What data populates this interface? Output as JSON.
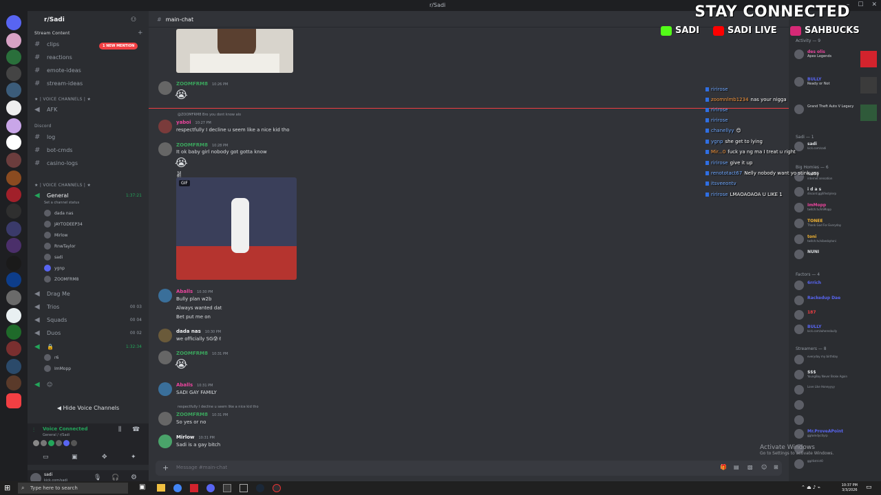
{
  "window": {
    "title": "r/Sadi"
  },
  "server": {
    "name": "r/Sadi",
    "mention_badge": "1 NEW MENTION"
  },
  "channels": {
    "stream_content_label": "Stream Content",
    "text": [
      {
        "name": "clips"
      },
      {
        "name": "reactions"
      },
      {
        "name": "emote-ideas"
      },
      {
        "name": "stream-ideas"
      }
    ],
    "voice_cat_1": "★ | VOICE CHANNELS | ★",
    "afk": "AFK",
    "discord_cat": "Discord",
    "text2": [
      {
        "name": "log"
      },
      {
        "name": "bot-cmds"
      },
      {
        "name": "casino-logs"
      }
    ],
    "voice_cat_2": "★ | VOICE CHANNELS | ★",
    "general": {
      "name": "General",
      "timer": "1:37:21",
      "status": "Set a channel status"
    },
    "voice_users": [
      "dada nas",
      "JAYTODEEP34",
      "Mirlow",
      "RnwTaylor",
      "sadi",
      "ygnp",
      "ZOOMFRM8"
    ],
    "voice2": [
      {
        "name": "Drag Me",
        "count": ""
      },
      {
        "name": "Trios",
        "count": "00 03"
      },
      {
        "name": "Squads",
        "count": "00 04"
      },
      {
        "name": "Duos",
        "count": "00 02"
      }
    ],
    "locked_timer": "1:32:34",
    "locked_users": [
      "r6",
      "ImMopp"
    ],
    "hide_label": "Hide Voice Channels",
    "voice_connected": "Voice Connected",
    "voice_sub": "General / r/Sadi",
    "user_name": "sadi",
    "user_sub": "kick.com/sadi"
  },
  "chat": {
    "channel": "main-chat",
    "composer_placeholder": "Message #main-chat",
    "messages": [
      {
        "name": "ZOOMFRM8",
        "time": "10:26 PM",
        "text": "😭"
      },
      {
        "reply": "@ZOOMFRM8 Bro you dont know alo",
        "name": "yaboi",
        "time": "10:27 PM",
        "text": "respectfully I decline u seem like a nice kid tho"
      },
      {
        "name": "ZOOMFRM8",
        "time": "10:28 PM",
        "text": "It ok baby girl nobody got gotta know",
        "text2": "😭✌"
      },
      {
        "gif_label": "GIF"
      },
      {
        "name": "Aballs",
        "time": "10:30 PM",
        "text": "Bully plan w2b",
        "text2": "Always wanted dat",
        "text3": "Bet put me on"
      },
      {
        "name": "dada nas",
        "time": "10:30 PM",
        "text": "we officially SG😰✌"
      },
      {
        "name": "ZOOMFRM8",
        "time": "10:31 PM",
        "text": "😭"
      },
      {
        "name": "Aballs",
        "time": "10:31 PM",
        "text": "SADI GAY FAMILY"
      },
      {
        "reply": "respectfully I decline u seem like a nice kid tho",
        "name": "ZOOMFRM8",
        "time": "10:31 PM",
        "text": "So yes or no"
      },
      {
        "name": "Mirlow",
        "time": "10:31 PM",
        "text": "Sadi is a gay bitch"
      }
    ]
  },
  "overlay": {
    "heading": "STAY CONNECTED",
    "socials": [
      {
        "icon": "kick-icon",
        "label": "SADI",
        "color": "#53fc18"
      },
      {
        "icon": "youtube-icon",
        "label": "SADI LIVE",
        "color": "#ff0000"
      },
      {
        "icon": "instagram-icon",
        "label": "SAHBUCKS",
        "color": "#d62976"
      }
    ]
  },
  "stream_chat": [
    {
      "user": "ririrose",
      "text": ""
    },
    {
      "user": "zoomnlmb1234",
      "text": "nas your nigga"
    },
    {
      "user": "ririrose",
      "text": ""
    },
    {
      "user": "ririrose",
      "text": ""
    },
    {
      "user": "chanellyy",
      "text": "😊"
    },
    {
      "user": "ygnp",
      "text": "she get to lying"
    },
    {
      "user": "Mir...0",
      "text": "fuck ya ng ma I treat u right"
    },
    {
      "user": "ririrose",
      "text": "give it up"
    },
    {
      "user": "renototact67",
      "text": "Nelly nobody want yo stink ass"
    },
    {
      "user": "itsveeontv",
      "text": ""
    },
    {
      "user": "ririrose",
      "text": "LMAOAOAOA U LIKE 1"
    }
  ],
  "members": {
    "activity_label": "Activity — 9",
    "activity": [
      {
        "name": "des olis",
        "status": "Apex Legends"
      },
      {
        "name": "BULLY",
        "status": "Ready or Not"
      },
      {
        "name": "",
        "status": "Grand Theft Auto V Legacy"
      }
    ],
    "sadi_group": "Sadi — 1",
    "sadi_members": [
      {
        "name": "sadi",
        "status": "kick.com/sadi"
      }
    ],
    "homies_group": "Big Homies — 6",
    "homies": [
      {
        "name": "Nelly",
        "status": "internet sensation"
      },
      {
        "name": "i d a s",
        "status": "discord.gg/lifestylerp"
      },
      {
        "name": "ImMopp",
        "status": "twitch.tv/ImMopp"
      },
      {
        "name": "TONEE",
        "status": "Thank God For Everyday"
      },
      {
        "name": "toni",
        "status": "twitch.tv/vibesbytoni"
      },
      {
        "name": "NUNI",
        "status": ""
      }
    ],
    "factors_group": "Factors — 4",
    "factors": [
      {
        "name": "6rrich",
        "status": ""
      },
      {
        "name": "Rackedup Dae",
        "status": ""
      },
      {
        "name": "187",
        "status": ""
      },
      {
        "name": "BULLY",
        "status": "kick.com/wheresbully"
      }
    ],
    "streamers_group": "Streamers — 8",
    "streamers": [
      {
        "name": "",
        "status": "everyday my birthday"
      },
      {
        "name": "$$$",
        "status": "YoungBoy Never Broke Again"
      },
      {
        "name": "",
        "status": "Love Like Honeyyyy"
      },
      {
        "name": "",
        "status": ""
      },
      {
        "name": "",
        "status": ""
      },
      {
        "name": "Mr.ProveAPoint",
        "status": "gg/windycityrp"
      },
      {
        "name": "",
        "status": ""
      },
      {
        "name": "",
        "status": "gg/district0"
      }
    ]
  },
  "system": {
    "activate_title": "Activate Windows",
    "activate_sub": "Go to Settings to activate Windows.",
    "search_placeholder": "Type here to search",
    "time": "10:37 PM",
    "date": "3/3/2026"
  }
}
